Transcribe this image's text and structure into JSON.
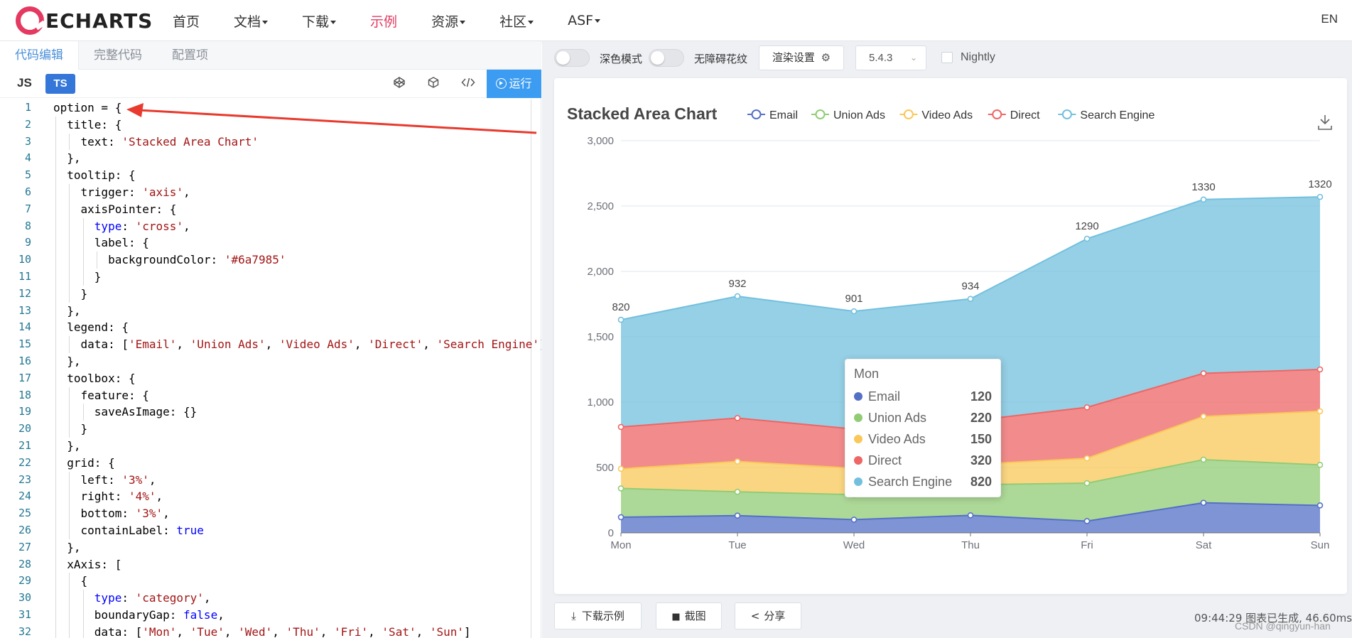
{
  "nav": {
    "logo": "ECHARTS",
    "items": [
      {
        "label": "首页",
        "dropdown": false,
        "active": false
      },
      {
        "label": "文档",
        "dropdown": true,
        "active": false
      },
      {
        "label": "下载",
        "dropdown": true,
        "active": false
      },
      {
        "label": "示例",
        "dropdown": false,
        "active": true
      },
      {
        "label": "资源",
        "dropdown": true,
        "active": false
      },
      {
        "label": "社区",
        "dropdown": true,
        "active": false
      },
      {
        "label": "ASF",
        "dropdown": true,
        "active": false
      }
    ],
    "lang": "EN"
  },
  "editor": {
    "tabs": [
      "代码编辑",
      "完整代码",
      "配置项"
    ],
    "lang_js": "JS",
    "lang_ts": "TS",
    "run_label": "运行",
    "lines": [
      "option = {",
      "  title: {",
      "    text: 'Stacked Area Chart'",
      "  },",
      "  tooltip: {",
      "    trigger: 'axis',",
      "    axisPointer: {",
      "      type: 'cross',",
      "      label: {",
      "        backgroundColor: '#6a7985'",
      "      }",
      "    }",
      "  },",
      "  legend: {",
      "    data: ['Email', 'Union Ads', 'Video Ads', 'Direct', 'Search Engine']",
      "  },",
      "  toolbox: {",
      "    feature: {",
      "      saveAsImage: {}",
      "    }",
      "  },",
      "  grid: {",
      "    left: '3%',",
      "    right: '4%',",
      "    bottom: '3%',",
      "    containLabel: true",
      "  },",
      "  xAxis: [",
      "    {",
      "      type: 'category',",
      "      boundaryGap: false,",
      "      data: ['Mon', 'Tue', 'Wed', 'Thu', 'Fri', 'Sat', 'Sun']"
    ]
  },
  "toolbar": {
    "dark_mode": "深色模式",
    "accessibility": "无障碍花纹",
    "render_settings": "渲染设置",
    "version": "5.4.3",
    "nightly": "Nightly"
  },
  "bottom": {
    "download": "下载示例",
    "screenshot": "截图",
    "share": "分享",
    "status": "09:44:29   图表已生成, 46.60ms",
    "watermark": "CSDN @qingyun-han"
  },
  "tooltip": {
    "title": "Mon",
    "rows": [
      {
        "name": "Email",
        "value": "120",
        "color": "#5470c6"
      },
      {
        "name": "Union Ads",
        "value": "220",
        "color": "#91cc75"
      },
      {
        "name": "Video Ads",
        "value": "150",
        "color": "#fac858"
      },
      {
        "name": "Direct",
        "value": "320",
        "color": "#ee6666"
      },
      {
        "name": "Search Engine",
        "value": "820",
        "color": "#73c0de"
      }
    ]
  },
  "chart_data": {
    "type": "area",
    "title": "Stacked Area Chart",
    "categories": [
      "Mon",
      "Tue",
      "Wed",
      "Thu",
      "Fri",
      "Sat",
      "Sun"
    ],
    "ylim": [
      0,
      3000
    ],
    "yticks": [
      "0",
      "500",
      "1,000",
      "1,500",
      "2,000",
      "2,500",
      "3,000"
    ],
    "stacked": true,
    "series": [
      {
        "name": "Email",
        "color": "#5470c6",
        "values": [
          120,
          132,
          101,
          134,
          90,
          230,
          210
        ]
      },
      {
        "name": "Union Ads",
        "color": "#91cc75",
        "values": [
          220,
          182,
          191,
          234,
          290,
          330,
          310
        ]
      },
      {
        "name": "Video Ads",
        "color": "#fac858",
        "values": [
          150,
          232,
          201,
          154,
          190,
          330,
          410
        ]
      },
      {
        "name": "Direct",
        "color": "#ee6666",
        "values": [
          320,
          332,
          301,
          334,
          390,
          330,
          320
        ]
      },
      {
        "name": "Search Engine",
        "color": "#73c0de",
        "values": [
          820,
          932,
          901,
          934,
          1290,
          1330,
          1320
        ],
        "labels": [
          "820",
          "932",
          "901",
          "934",
          "1290",
          "1330",
          "1320"
        ]
      }
    ],
    "legend_position": "top",
    "grid": true
  }
}
